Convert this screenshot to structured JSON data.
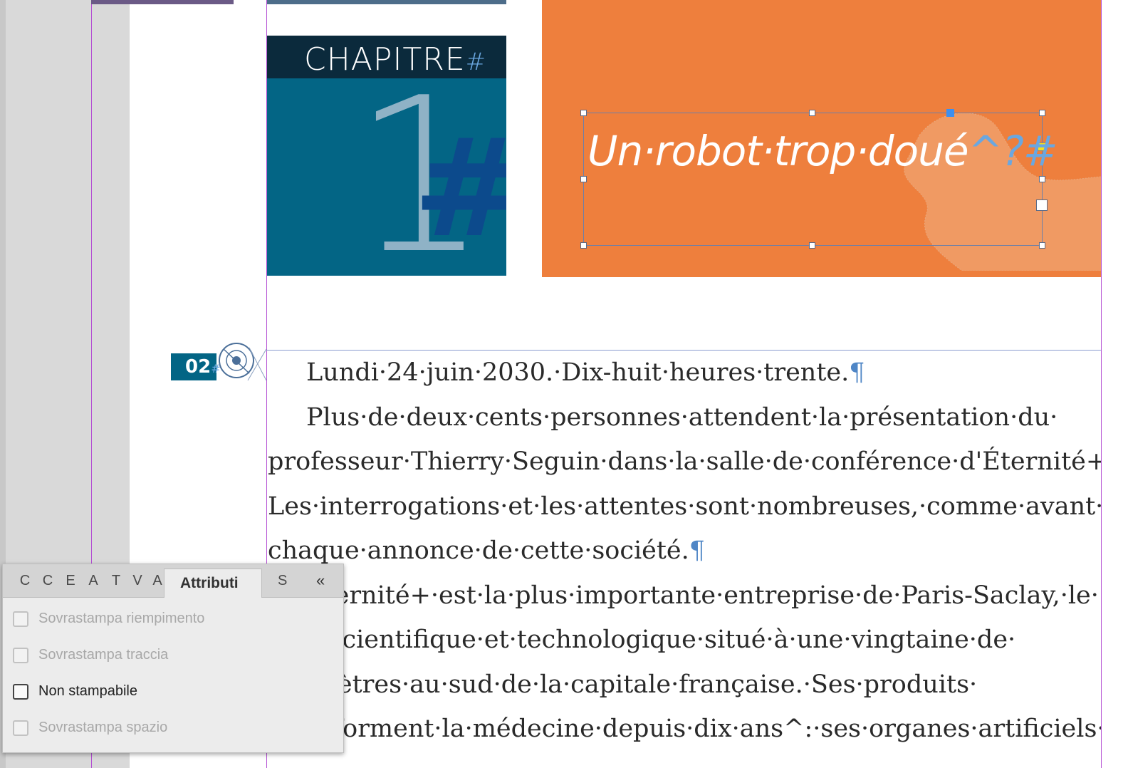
{
  "chapter": {
    "word": "CHAPITRE",
    "hash_small": "#",
    "number": "1",
    "hash_big": "#"
  },
  "title_frame": {
    "text": "Un·robot·trop·doué",
    "marks": "^?#"
  },
  "page_number": {
    "value": "02",
    "hash": "#"
  },
  "body": {
    "paragraphs": [
      {
        "text": "Lundi·24·juin·2030.·Dix-huit·heures·trente.",
        "end": "¶"
      },
      {
        "text": "Plus·de·deux·cents·personnes·attendent·la·présentation·du·",
        "end": ""
      },
      {
        "text": "professeur·Thierry·Seguin·dans·la·salle·de·conférence·d'Éternité+.·",
        "end": ""
      },
      {
        "text": "Les·interrogations·et·les·attentes·sont·nombreuses,·comme·avant·",
        "end": ""
      },
      {
        "text": "chaque·annonce·de·cette·société.",
        "end": "¶"
      },
      {
        "text": "Éternité+·est·la·plus·importante·entreprise·de·Paris-Saclay,·le·",
        "end": ""
      },
      {
        "text": "pôle·scientifique·et·technologique·situé·à·une·vingtaine·de·",
        "end": ""
      },
      {
        "text": "kilomètres·au·sud·de·la·capitale·française.·Ses·produits·",
        "end": ""
      },
      {
        "text": "transforment·la·médecine·depuis·dix·ans^:·ses·organes·artificiels·",
        "end": ""
      }
    ]
  },
  "panel": {
    "tabs_collapsed": [
      "C",
      "C",
      "E",
      "A",
      "T",
      "V",
      "A"
    ],
    "active_tab": "Attributi",
    "tab_after": "S",
    "collapse_icon": "«",
    "options": [
      {
        "label": "Sovrastampa riempimento",
        "checked": false,
        "enabled": false
      },
      {
        "label": "Sovrastampa traccia",
        "checked": false,
        "enabled": false
      },
      {
        "label": "Non stampabile",
        "checked": false,
        "enabled": true
      },
      {
        "label": "Sovrastampa spazio",
        "checked": false,
        "enabled": false
      }
    ]
  },
  "colors": {
    "chapter_blue": "#036585",
    "orange": "#ee7f3d",
    "invisible_marks": "#6aa7e0",
    "guide": "#b44fd3"
  }
}
